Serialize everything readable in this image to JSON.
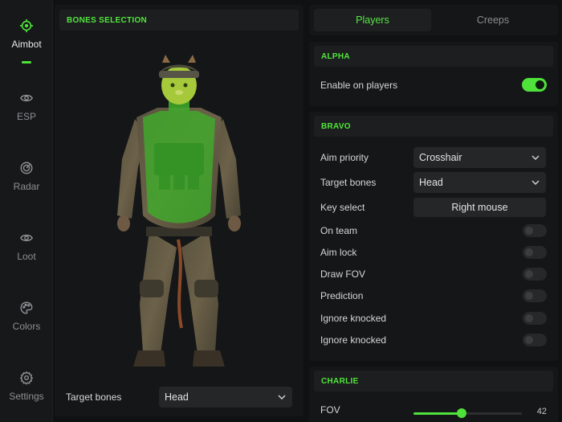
{
  "sidebar": {
    "items": [
      {
        "label": "Aimbot",
        "icon": "crosshair-icon",
        "active": true
      },
      {
        "label": "ESP",
        "icon": "eye-icon"
      },
      {
        "label": "Radar",
        "icon": "radar-icon"
      },
      {
        "label": "Loot",
        "icon": "eye-icon"
      },
      {
        "label": "Colors",
        "icon": "palette-icon"
      },
      {
        "label": "Settings",
        "icon": "gear-icon"
      }
    ]
  },
  "bones": {
    "header": "BONES SELECTION",
    "target_label": "Target bones",
    "target_value": "Head"
  },
  "tabs": [
    {
      "label": "Players",
      "active": true
    },
    {
      "label": "Creeps"
    }
  ],
  "alpha": {
    "header": "ALPHA",
    "enable_label": "Enable on players",
    "enable_on": true
  },
  "bravo": {
    "header": "BRAVO",
    "aim_priority_label": "Aim priority",
    "aim_priority_value": "Crosshair",
    "target_bones_label": "Target bones",
    "target_bones_value": "Head",
    "key_select_label": "Key select",
    "key_select_value": "Right mouse",
    "toggles": [
      {
        "label": "On team",
        "on": false
      },
      {
        "label": "Aim lock",
        "on": false
      },
      {
        "label": "Draw FOV",
        "on": false
      },
      {
        "label": "Prediction",
        "on": false
      },
      {
        "label": "Ignore knocked",
        "on": false
      },
      {
        "label": "Ignore knocked",
        "on": false
      }
    ]
  },
  "charlie": {
    "header": "CHARLIE",
    "fov_label": "FOV",
    "fov_value": "42"
  },
  "colors": {
    "accent": "#4fe23b",
    "background": "#101112",
    "panel": "#151617"
  }
}
